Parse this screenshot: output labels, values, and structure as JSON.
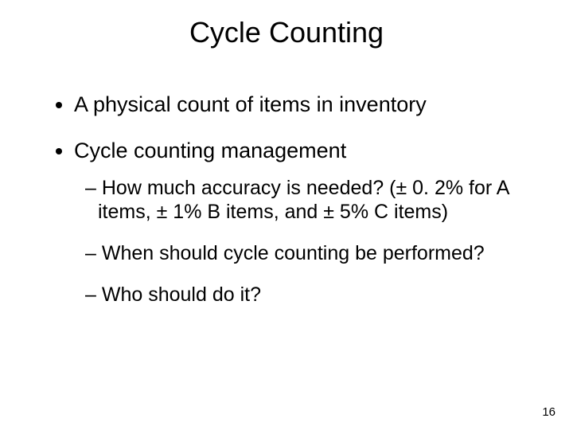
{
  "title": "Cycle Counting",
  "bullets": {
    "b0": "A physical count of items  in inventory",
    "b1": "Cycle counting management",
    "sub": {
      "s0": "How much accuracy is needed? (± 0. 2% for A items, ± 1% B items, and ± 5% C items)",
      "s1": "When should cycle counting be performed?",
      "s2": "Who should do it?"
    }
  },
  "page_number": "16"
}
